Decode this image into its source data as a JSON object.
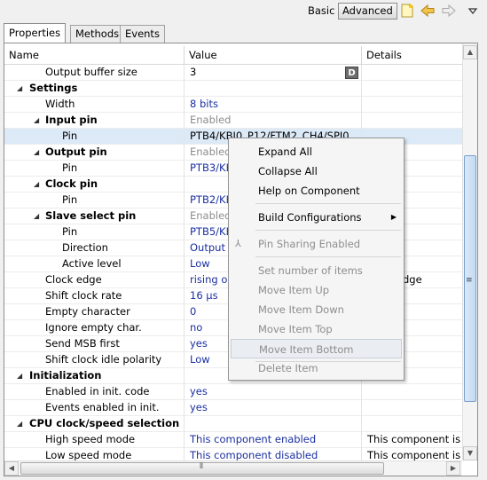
{
  "toolbar": {
    "basic": "Basic",
    "advanced": "Advanced"
  },
  "tabs": [
    "Properties",
    "Methods",
    "Events"
  ],
  "columns": {
    "name": "Name",
    "value": "Value",
    "details": "Details"
  },
  "rows": [
    {
      "name": "Output buffer size",
      "value": "3",
      "details": "",
      "badge": "D"
    },
    {
      "name": "Settings",
      "value": "",
      "details": ""
    },
    {
      "name": "Width",
      "value": "8 bits",
      "details": ""
    },
    {
      "name": "Input pin",
      "value": "Enabled",
      "details": ""
    },
    {
      "name": "Pin",
      "value": "PTB4/KBI0_P12/FTM2_CH4/SPI0_",
      "details": ""
    },
    {
      "name": "Output pin",
      "value": "Enabled",
      "details": ""
    },
    {
      "name": "Pin",
      "value": "PTB3/KE",
      "details": ""
    },
    {
      "name": "Clock pin",
      "value": "",
      "details": ""
    },
    {
      "name": "Pin",
      "value": "PTB2/KE",
      "details": ""
    },
    {
      "name": "Slave select pin",
      "value": "Enabled",
      "details": ""
    },
    {
      "name": "Pin",
      "value": "PTB5/KE",
      "details": ""
    },
    {
      "name": "Direction",
      "value": "Output",
      "details": ""
    },
    {
      "name": "Active level",
      "value": "Low",
      "details": ""
    },
    {
      "name": "Clock edge",
      "value": "rising or",
      "details": "dge"
    },
    {
      "name": "Shift clock rate",
      "value": "16 µs",
      "details": ""
    },
    {
      "name": "Empty character",
      "value": "0",
      "details": ""
    },
    {
      "name": "Ignore empty char.",
      "value": "no",
      "details": ""
    },
    {
      "name": "Send MSB first",
      "value": "yes",
      "details": ""
    },
    {
      "name": "Shift clock idle polarity",
      "value": "Low",
      "details": ""
    },
    {
      "name": "Initialization",
      "value": "",
      "details": ""
    },
    {
      "name": "Enabled in init. code",
      "value": "yes",
      "details": ""
    },
    {
      "name": "Events enabled in init.",
      "value": "yes",
      "details": ""
    },
    {
      "name": "CPU clock/speed selection",
      "value": "",
      "details": ""
    },
    {
      "name": "High speed mode",
      "value": "This component enabled",
      "details": "This component is e"
    },
    {
      "name": "Low speed mode",
      "value": "This component disabled",
      "details": "This component is d"
    }
  ],
  "context_menu": {
    "expand_all": "Expand All",
    "collapse_all": "Collapse All",
    "help": "Help on Component",
    "build_configurations": "Build Configurations",
    "pin_sharing": "Pin Sharing Enabled",
    "set_number": "Set number of items",
    "move_up": "Move Item Up",
    "move_down": "Move Item Down",
    "move_top": "Move Item Top",
    "move_bottom": "Move Item Bottom",
    "delete_item": "Delete Item"
  },
  "colors": {
    "link_value": "#1a2fa0",
    "disabled": "#8c8c8c",
    "selected_row": "#dceaf8"
  }
}
